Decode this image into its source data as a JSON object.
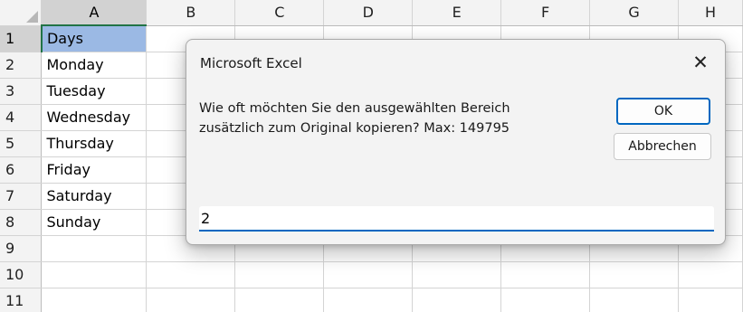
{
  "columns": [
    "A",
    "B",
    "C",
    "D",
    "E",
    "F",
    "G",
    "H"
  ],
  "rows": [
    {
      "num": "1",
      "a": "Days"
    },
    {
      "num": "2",
      "a": "Monday"
    },
    {
      "num": "3",
      "a": "Tuesday"
    },
    {
      "num": "4",
      "a": "Wednesday"
    },
    {
      "num": "5",
      "a": "Thursday"
    },
    {
      "num": "6",
      "a": "Friday"
    },
    {
      "num": "7",
      "a": "Saturday"
    },
    {
      "num": "8",
      "a": "Sunday"
    },
    {
      "num": "9",
      "a": ""
    },
    {
      "num": "10",
      "a": ""
    },
    {
      "num": "11",
      "a": ""
    }
  ],
  "selection": {
    "column": "A",
    "row": "1",
    "color": "#9bb9e4"
  },
  "dialog": {
    "title": "Microsoft Excel",
    "close_icon": "close-icon",
    "close_glyph": "✕",
    "message_line1": "Wie oft möchten Sie den ausgewählten Bereich",
    "message_line2": "zusätzlich zum Original kopieren? Max: 149795",
    "ok_label": "OK",
    "cancel_label": "Abbrechen",
    "input_value": "2"
  },
  "colors": {
    "accent": "#0067c0",
    "header_bg": "#f3f3f3",
    "dialog_bg": "#f3f3f3"
  }
}
